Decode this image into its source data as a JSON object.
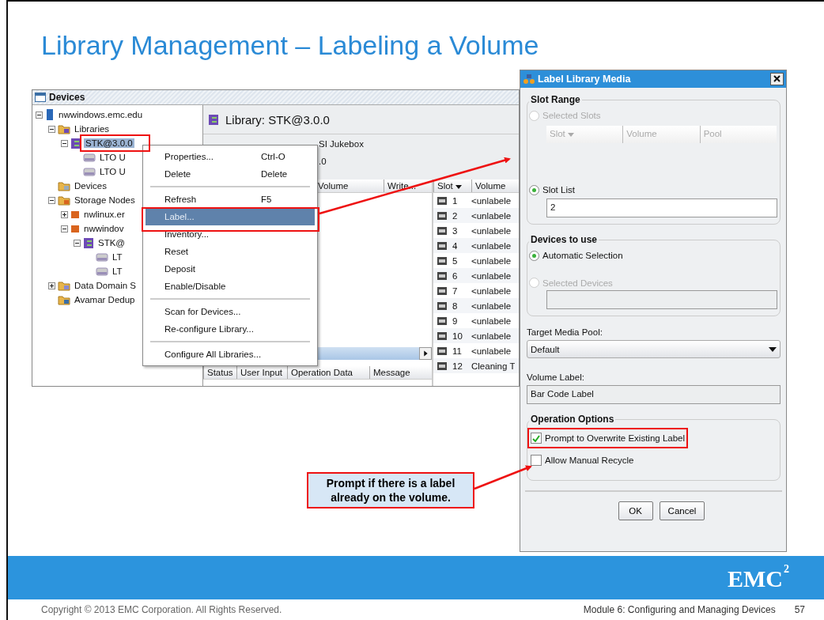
{
  "slide": {
    "title": "Library Management – Labeling a Volume"
  },
  "devices_window": {
    "title": "Devices",
    "tree": [
      {
        "label": "nwwindows.emc.edu",
        "kind": "host",
        "expanded": true,
        "selected": false,
        "children": [
          {
            "label": "Libraries",
            "kind": "library-folder",
            "expanded": true,
            "selected": false,
            "children": [
              {
                "label": "STK@3.0.0",
                "kind": "library",
                "expanded": true,
                "selected": true,
                "children": [
                  {
                    "label": "LTO U",
                    "kind": "drive",
                    "selected": false
                  },
                  {
                    "label": "LTO U",
                    "kind": "drive",
                    "selected": false
                  }
                ]
              }
            ]
          },
          {
            "label": "Devices",
            "kind": "device-folder",
            "selected": false
          },
          {
            "label": "Storage Nodes",
            "kind": "node-folder",
            "expanded": true,
            "selected": false,
            "children": [
              {
                "label": "nwlinux.er",
                "kind": "node",
                "expanded": false,
                "selected": false
              },
              {
                "label": "nwwindov",
                "kind": "node",
                "expanded": true,
                "selected": false,
                "children": [
                  {
                    "label": "STK@",
                    "kind": "library",
                    "expanded": true,
                    "selected": false,
                    "children": [
                      {
                        "label": "LT",
                        "kind": "drive",
                        "selected": false
                      },
                      {
                        "label": "LT",
                        "kind": "drive",
                        "selected": false
                      }
                    ]
                  }
                ]
              }
            ]
          },
          {
            "label": "Data Domain S",
            "kind": "dd-folder",
            "expanded": false,
            "selected": false
          },
          {
            "label": "Avamar Dedup",
            "kind": "avamar-folder",
            "selected": false
          }
        ]
      }
    ],
    "library_header": "Library: STK@3.0.0",
    "info_lines": [
      "SI Jukebox",
      ".0"
    ],
    "device_table": {
      "columns": [
        "Volume",
        "Write..."
      ]
    },
    "operations_table": {
      "columns": [
        "Status",
        "User Input",
        "Operation Data",
        "Message"
      ]
    },
    "slot_table": {
      "columns": [
        "Slot",
        "Volume"
      ],
      "rows": [
        {
          "slot": "1",
          "volume": "<unlabele"
        },
        {
          "slot": "2",
          "volume": "<unlabele"
        },
        {
          "slot": "3",
          "volume": "<unlabele"
        },
        {
          "slot": "4",
          "volume": "<unlabele"
        },
        {
          "slot": "5",
          "volume": "<unlabele"
        },
        {
          "slot": "6",
          "volume": "<unlabele"
        },
        {
          "slot": "7",
          "volume": "<unlabele"
        },
        {
          "slot": "8",
          "volume": "<unlabele"
        },
        {
          "slot": "9",
          "volume": "<unlabele"
        },
        {
          "slot": "10",
          "volume": "<unlabele"
        },
        {
          "slot": "11",
          "volume": "<unlabele"
        },
        {
          "slot": "12",
          "volume": "Cleaning T"
        }
      ]
    },
    "context_menu": [
      {
        "kind": "item",
        "label": "Properties...",
        "shortcut": "Ctrl-O",
        "selected": false
      },
      {
        "kind": "item",
        "label": "Delete",
        "shortcut": "Delete",
        "selected": false
      },
      {
        "kind": "separator"
      },
      {
        "kind": "item",
        "label": "Refresh",
        "shortcut": "F5",
        "selected": false
      },
      {
        "kind": "item",
        "label": "Label...",
        "selected": true
      },
      {
        "kind": "item",
        "label": "Inventory...",
        "selected": false
      },
      {
        "kind": "item",
        "label": "Reset",
        "selected": false
      },
      {
        "kind": "item",
        "label": "Deposit",
        "selected": false
      },
      {
        "kind": "item",
        "label": "Enable/Disable",
        "selected": false
      },
      {
        "kind": "separator"
      },
      {
        "kind": "item",
        "label": "Scan for Devices...",
        "selected": false
      },
      {
        "kind": "item",
        "label": "Re-configure Library...",
        "selected": false
      },
      {
        "kind": "separator"
      },
      {
        "kind": "item",
        "label": "Configure All Libraries...",
        "selected": false
      }
    ]
  },
  "dialog": {
    "title": "Label Library Media",
    "slot_range": {
      "title": "Slot Range",
      "options": [
        {
          "label": "Selected Slots",
          "selected": false,
          "disabled": true
        },
        {
          "label": "Slot List",
          "selected": true,
          "disabled": false
        }
      ],
      "slot_columns": [
        "Slot",
        "Volume",
        "Pool"
      ],
      "slot_list_value": "2"
    },
    "devices": {
      "title": "Devices to use",
      "options": [
        {
          "label": "Automatic Selection",
          "selected": true,
          "disabled": false
        },
        {
          "label": "Selected Devices",
          "selected": false,
          "disabled": true
        }
      ]
    },
    "pool_label": "Target Media Pool:",
    "pool_value": "Default",
    "volume_label": "Volume Label:",
    "volume_value": "Bar Code Label",
    "operation_options": {
      "title": "Operation Options",
      "options": [
        {
          "label": "Prompt to Overwrite Existing Label",
          "checked": true,
          "highlighted": true
        },
        {
          "label": "Allow Manual Recycle",
          "checked": false,
          "highlighted": false
        }
      ]
    },
    "buttons": [
      "OK",
      "Cancel"
    ]
  },
  "callout": "Prompt if there is a label already on the volume.",
  "footer": {
    "logo": "EMC$^{2}$",
    "copyright": "Copyright © 2013 EMC Corporation. All Rights Reserved.",
    "module": "Module 6: Configuring and Managing Devices",
    "page": "57"
  }
}
